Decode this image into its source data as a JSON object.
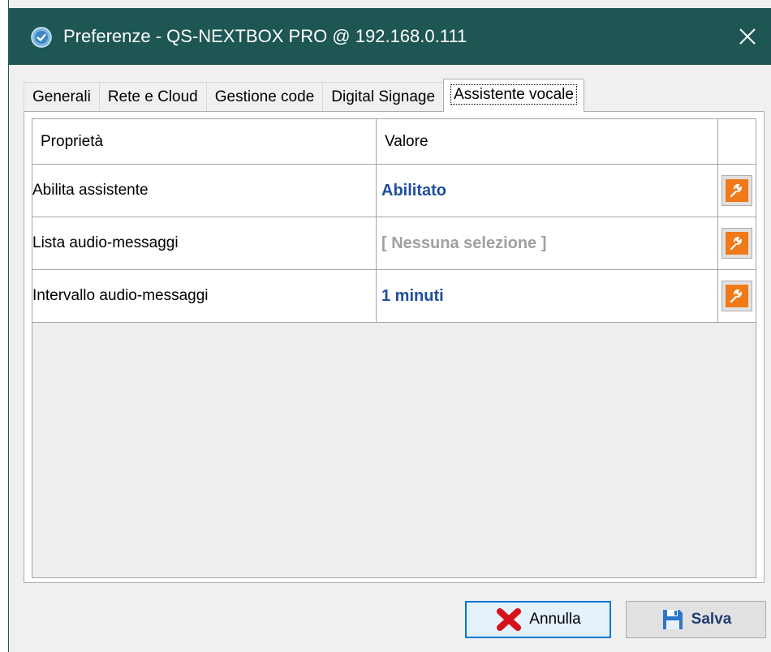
{
  "window": {
    "title": "Preferenze - QS-NEXTBOX PRO @ 192.168.0.111",
    "app_icon": "checkmark-badge-icon",
    "close_icon": "close-icon"
  },
  "tabs": [
    {
      "label": "Generali",
      "active": false
    },
    {
      "label": "Rete e Cloud",
      "active": false
    },
    {
      "label": "Gestione code",
      "active": false
    },
    {
      "label": "Digital Signage",
      "active": false
    },
    {
      "label": "Assistente vocale",
      "active": true
    }
  ],
  "grid": {
    "headers": {
      "property": "Proprietà",
      "value": "Valore"
    },
    "rows": [
      {
        "property": "Abilita assistente",
        "value": "Abilitato",
        "edit_icon": "wrench-icon"
      },
      {
        "property": "Lista audio-messaggi",
        "value": "[ Nessuna selezione ]",
        "edit_icon": "wrench-icon"
      },
      {
        "property": "Intervallo audio-messaggi",
        "value": "1 minuti",
        "edit_icon": "wrench-icon"
      }
    ]
  },
  "buttons": {
    "cancel": {
      "label": "Annulla",
      "icon": "red-x-icon"
    },
    "save": {
      "label": "Salva",
      "icon": "floppy-disk-icon"
    }
  },
  "colors": {
    "titlebar": "#1d5652",
    "value_blue": "#1f4e9c",
    "value_gray": "#a0a0a0",
    "edit_orange": "#f07a19",
    "focus_blue": "#0078d7"
  }
}
